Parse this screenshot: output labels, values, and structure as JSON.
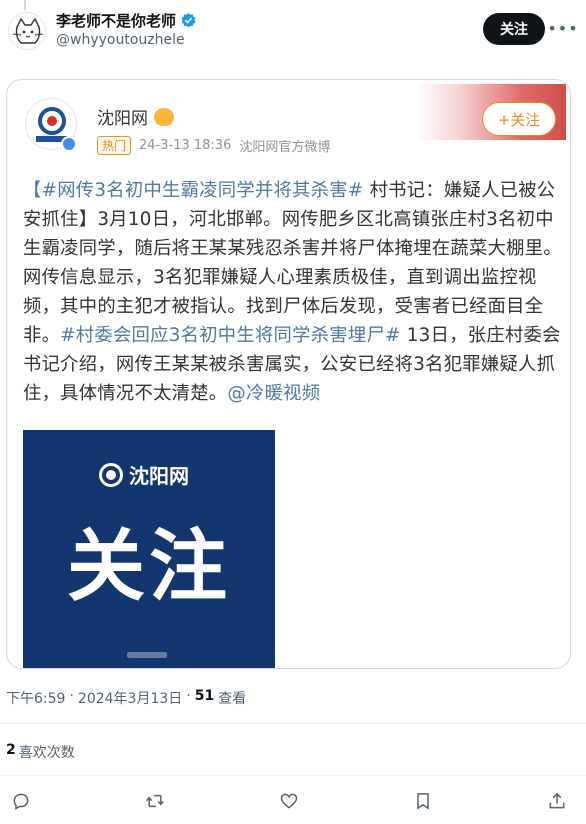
{
  "author": {
    "display_name": "李老师不是你老师",
    "handle": "@whyyoutouzhele",
    "verified": true,
    "follow_label": "关注",
    "more_icon": "more-icon"
  },
  "embedded": {
    "source_name": "沈阳网",
    "hot_badge": "热门",
    "date": "24-3-13 18:36",
    "via": "沈阳网官方微博",
    "follow_label": "+关注",
    "text": {
      "tag1": "【#网传3名初中生霸凌同学并将其杀害#",
      "part1": " 村书记：嫌疑人已被公安抓住】3月10日，河北邯郸。网传肥乡区北高镇张庄村3名初中生霸凌同学，随后将王某某残忍杀害并将尸体掩埋在蔬菜大棚里。网传信息显示，3名犯罪嫌疑人心理素质极佳，直到调出监控视频，其中的主犯才被指认。找到尸体后发现，受害者已经面目全非。",
      "tag2": "#村委会回应3名初中生将同学杀害埋尸#",
      "part2": " 13日，张庄村委会书记介绍，网传王某某被杀害属实，公安已经将3名犯罪嫌疑人抓住，具体情况不太清楚。",
      "mention": "@冷暖视频"
    },
    "image": {
      "logo_text": "沈阳网",
      "title": "关注"
    }
  },
  "footer": {
    "time": "下午6:59",
    "separator": "·",
    "date": "2024年3月13日",
    "views_count": "51",
    "views_label": "查看",
    "likes_count": "2",
    "likes_label": "喜欢次数"
  },
  "colors": {
    "link": "#5079a3",
    "hot": "#f08a24",
    "image_bg": "#12366e"
  }
}
